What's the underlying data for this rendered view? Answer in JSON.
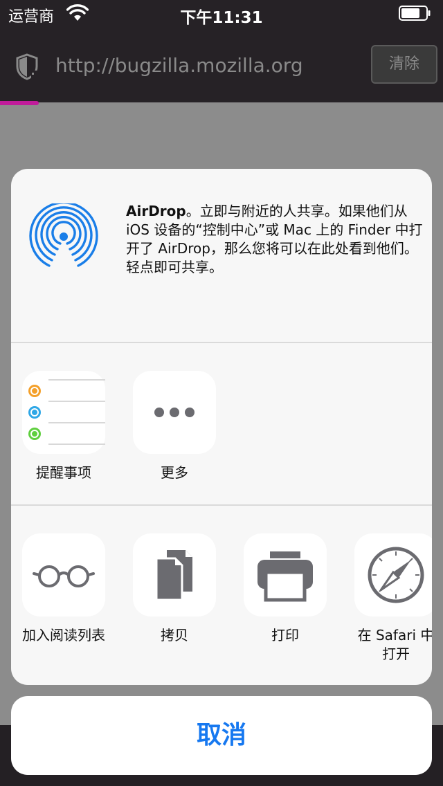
{
  "status_bar": {
    "carrier": "运营商",
    "time": "下午11:31"
  },
  "browser": {
    "url": "http://bugzilla.mozilla.org",
    "clear_label": "清除"
  },
  "share_sheet": {
    "airdrop": {
      "title": "AirDrop",
      "description": "。立即与附近的人共享。如果他们从 iOS 设备的“控制中心”或 Mac 上的 Finder 中打开了 AirDrop，那么您将可以在此处看到他们。轻点即可共享。"
    },
    "apps": [
      {
        "label": "提醒事项",
        "icon": "reminders-icon"
      },
      {
        "label": "更多",
        "icon": "more-icon"
      }
    ],
    "actions": [
      {
        "label": "加入阅读列表",
        "icon": "reading-glasses-icon"
      },
      {
        "label": "拷贝",
        "icon": "copy-icon"
      },
      {
        "label": "打印",
        "icon": "printer-icon"
      },
      {
        "label": "在 Safari 中\n打开",
        "label_line1": "在 Safari 中",
        "label_line2": "打开",
        "icon": "safari-compass-icon"
      }
    ],
    "cancel_label": "取消"
  },
  "colors": {
    "accent": "#1678f0",
    "airdrop_blue": "#1a7ee8",
    "progress": "#c01b9a"
  }
}
